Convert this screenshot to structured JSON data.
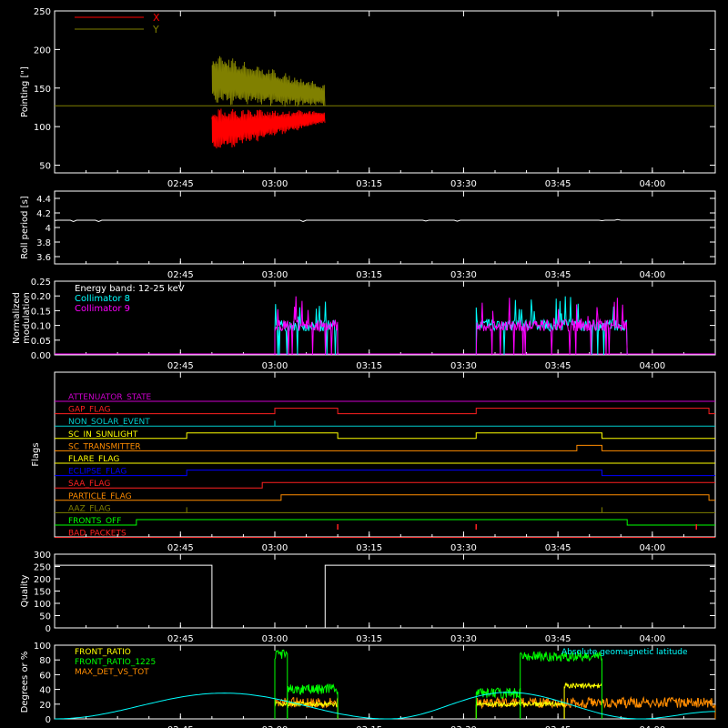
{
  "colors": {
    "background": "#000000",
    "axes": "#ffffff",
    "pointing_x": "#ff0000",
    "pointing_y": "#808000",
    "collimator8": "#00ffff",
    "collimator9": "#ff00ff",
    "front_ratio": "#ffff00",
    "front_ratio_1225": "#00ff00",
    "max_det_vs_tot": "#ff8c00",
    "geomag": "#00ffff"
  },
  "time_ticks": [
    "02:45",
    "03:00",
    "03:15",
    "03:30",
    "03:45",
    "04:00"
  ],
  "time_range": [
    "02:25",
    "04:10"
  ],
  "chart_data": [
    {
      "id": "pointing",
      "type": "line",
      "ylabel": "Pointing [\"]",
      "ylim": [
        40,
        250
      ],
      "yticks": [
        50,
        100,
        150,
        200,
        250
      ],
      "baseline": 127,
      "legend": [
        {
          "label": "X",
          "color": "#ff0000"
        },
        {
          "label": "Y",
          "color": "#808000"
        }
      ],
      "series": [
        {
          "name": "X",
          "t_start": "02:50",
          "t_end": "03:08",
          "mean_start": 95,
          "mean_end": 112,
          "amp_start": 30,
          "amp_end": 8
        },
        {
          "name": "Y",
          "t_start": "02:50",
          "t_end": "03:08",
          "mean_start": 162,
          "mean_end": 140,
          "amp_start": 35,
          "amp_end": 15
        }
      ]
    },
    {
      "id": "roll",
      "type": "line",
      "ylabel": "Roll period [s]",
      "ylim": [
        3.5,
        4.5
      ],
      "yticks": [
        3.6,
        3.8,
        4.0,
        4.2,
        4.4
      ],
      "series": [
        {
          "name": "Roll period",
          "value": 4.1
        }
      ]
    },
    {
      "id": "modulation",
      "type": "line",
      "ylabel": "Normalized modulation",
      "ylim": [
        0,
        0.25
      ],
      "yticks": [
        0.0,
        0.05,
        0.1,
        0.15,
        0.2,
        0.25
      ],
      "ytick_labels": [
        "0.00",
        "0.05",
        "0.10",
        "0.15",
        "0.20",
        "0.25"
      ],
      "legend": [
        {
          "label": "Energy band: 12-25 keV",
          "color": "#ffffff"
        },
        {
          "label": "Collimator 8",
          "color": "#00ffff"
        },
        {
          "label": "Collimator 9",
          "color": "#ff00ff"
        }
      ],
      "active_intervals": [
        [
          "03:00",
          "03:10"
        ],
        [
          "03:32",
          "03:56"
        ]
      ],
      "series": [
        {
          "name": "Collimator 8",
          "level": 0.1
        },
        {
          "name": "Collimator 9",
          "level": 0.1
        }
      ]
    },
    {
      "id": "flags",
      "type": "table",
      "ylabel": "Flags",
      "rows": [
        {
          "label": "ATTENUATOR_STATE",
          "color": "#cc00cc",
          "steps": []
        },
        {
          "label": "GAP_FLAG",
          "color": "#ff2020",
          "steps": [
            "03:00",
            "03:10",
            "03:32",
            "04:09"
          ]
        },
        {
          "label": "NON_SOLAR_EVENT",
          "color": "#00cccc",
          "steps": [
            "03:00",
            "03:00"
          ]
        },
        {
          "label": "SC_IN_SUNLIGHT",
          "color": "#ffff00",
          "steps": [
            "02:46",
            "03:10",
            "03:32",
            "03:52"
          ]
        },
        {
          "label": "SC_TRANSMITTER",
          "color": "#ff8c00",
          "steps": [
            "03:48",
            "03:52"
          ]
        },
        {
          "label": "FLARE_FLAG",
          "color": "#ffff00",
          "steps": []
        },
        {
          "label": "ECLIPSE_FLAG",
          "color": "#0000ff",
          "steps": [
            "02:46",
            "03:52"
          ]
        },
        {
          "label": "SAA_FLAG",
          "color": "#ff2020",
          "steps": [
            "02:58"
          ]
        },
        {
          "label": "PARTICLE_FLAG",
          "color": "#ff8c00",
          "steps": [
            "03:01",
            "04:09"
          ]
        },
        {
          "label": "AAZ_FLAG",
          "color": "#808000",
          "steps": [
            "02:46",
            "02:46",
            "03:52",
            "03:52"
          ]
        },
        {
          "label": "FRONTS_OFF",
          "color": "#00ff00",
          "steps": [
            "02:38",
            "03:56"
          ]
        },
        {
          "label": "BAD_PACKETS",
          "color": "#ff2020",
          "steps": []
        }
      ],
      "spikes": [
        "03:10",
        "03:32",
        "04:07"
      ]
    },
    {
      "id": "quality",
      "type": "line",
      "ylabel": "Quality",
      "ylim": [
        0,
        300
      ],
      "yticks": [
        0,
        50,
        100,
        150,
        200,
        250,
        300
      ],
      "series": [
        {
          "name": "Quality",
          "points": [
            [
              "02:25",
              255
            ],
            [
              "02:50",
              255
            ],
            [
              "02:50",
              0
            ],
            [
              "03:08",
              0
            ],
            [
              "03:08",
              255
            ],
            [
              "04:10",
              255
            ]
          ]
        }
      ]
    },
    {
      "id": "ratios",
      "type": "line",
      "ylabel": "Degrees or %",
      "ylim": [
        0,
        100
      ],
      "yticks": [
        0,
        20,
        40,
        60,
        80,
        100
      ],
      "legend": [
        {
          "label": "FRONT_RATIO",
          "color": "#ffff00"
        },
        {
          "label": "FRONT_RATIO_1225",
          "color": "#00ff00"
        },
        {
          "label": "MAX_DET_VS_TOT",
          "color": "#ff8c00"
        }
      ],
      "annotation": "Absolute geomagnetic latitude",
      "series": [
        {
          "name": "FRONT_RATIO",
          "intervals": [
            [
              "03:00",
              "03:10",
              20
            ],
            [
              "03:32",
              "03:46",
              20
            ],
            [
              "03:46",
              "03:52",
              45
            ]
          ]
        },
        {
          "name": "FRONT_RATIO_1225",
          "intervals": [
            [
              "03:00",
              "03:02",
              88
            ],
            [
              "03:02",
              "03:10",
              40
            ],
            [
              "03:32",
              "03:39",
              35
            ],
            [
              "03:39",
              "03:52",
              85
            ]
          ]
        },
        {
          "name": "MAX_DET_VS_TOT",
          "intervals": [
            [
              "03:00",
              "03:10",
              22
            ],
            [
              "03:32",
              "04:10",
              22
            ]
          ]
        },
        {
          "name": "Absolute geomagnetic latitude",
          "peaks": [
            [
              "02:52",
              35
            ],
            [
              "03:37",
              36
            ],
            [
              "04:10",
              10
            ]
          ],
          "troughs": [
            [
              "02:25",
              0
            ],
            [
              "03:18",
              0
            ],
            [
              "03:58",
              0
            ]
          ]
        }
      ]
    }
  ]
}
